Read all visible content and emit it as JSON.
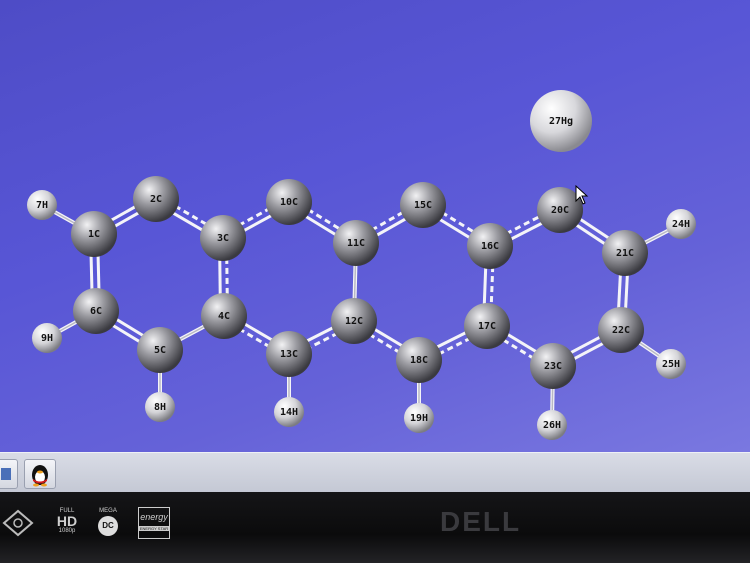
{
  "viewer": {
    "atoms": [
      {
        "id": "1C",
        "label": "1C",
        "el": "C"
      },
      {
        "id": "2C",
        "label": "2C",
        "el": "C"
      },
      {
        "id": "3C",
        "label": "3C",
        "el": "C"
      },
      {
        "id": "4C",
        "label": "4C",
        "el": "C"
      },
      {
        "id": "5C",
        "label": "5C",
        "el": "C"
      },
      {
        "id": "6C",
        "label": "6C",
        "el": "C"
      },
      {
        "id": "7H",
        "label": "7H",
        "el": "H"
      },
      {
        "id": "8H",
        "label": "8H",
        "el": "H"
      },
      {
        "id": "9H",
        "label": "9H",
        "el": "H"
      },
      {
        "id": "10C",
        "label": "10C",
        "el": "C"
      },
      {
        "id": "11C",
        "label": "11C",
        "el": "C"
      },
      {
        "id": "12C",
        "label": "12C",
        "el": "C"
      },
      {
        "id": "13C",
        "label": "13C",
        "el": "C"
      },
      {
        "id": "14H",
        "label": "14H",
        "el": "H"
      },
      {
        "id": "15C",
        "label": "15C",
        "el": "C"
      },
      {
        "id": "16C",
        "label": "16C",
        "el": "C"
      },
      {
        "id": "17C",
        "label": "17C",
        "el": "C"
      },
      {
        "id": "18C",
        "label": "18C",
        "el": "C"
      },
      {
        "id": "19H",
        "label": "19H",
        "el": "H"
      },
      {
        "id": "20C",
        "label": "20C",
        "el": "C"
      },
      {
        "id": "21C",
        "label": "21C",
        "el": "C"
      },
      {
        "id": "22C",
        "label": "22C",
        "el": "C"
      },
      {
        "id": "23C",
        "label": "23C",
        "el": "C"
      },
      {
        "id": "24H",
        "label": "24H",
        "el": "H"
      },
      {
        "id": "25H",
        "label": "25H",
        "el": "H"
      },
      {
        "id": "26H",
        "label": "26H",
        "el": "H"
      },
      {
        "id": "27Hg",
        "label": "27Hg",
        "el": "Hg"
      }
    ],
    "bonds": [
      [
        "1C",
        "2C",
        "double"
      ],
      [
        "2C",
        "3C",
        "aromatic"
      ],
      [
        "3C",
        "4C",
        "aromatic"
      ],
      [
        "4C",
        "5C",
        "single"
      ],
      [
        "5C",
        "6C",
        "double"
      ],
      [
        "6C",
        "1C",
        "double"
      ],
      [
        "1C",
        "7H",
        "single"
      ],
      [
        "6C",
        "9H",
        "single"
      ],
      [
        "5C",
        "8H",
        "single"
      ],
      [
        "3C",
        "10C",
        "aromatic"
      ],
      [
        "10C",
        "11C",
        "aromatic"
      ],
      [
        "11C",
        "12C",
        "single"
      ],
      [
        "12C",
        "13C",
        "aromatic"
      ],
      [
        "13C",
        "4C",
        "aromatic"
      ],
      [
        "13C",
        "14H",
        "single"
      ],
      [
        "11C",
        "15C",
        "aromatic"
      ],
      [
        "15C",
        "16C",
        "aromatic"
      ],
      [
        "16C",
        "17C",
        "aromatic"
      ],
      [
        "17C",
        "18C",
        "aromatic"
      ],
      [
        "18C",
        "12C",
        "aromatic"
      ],
      [
        "18C",
        "19H",
        "single"
      ],
      [
        "16C",
        "20C",
        "aromatic"
      ],
      [
        "20C",
        "21C",
        "double"
      ],
      [
        "21C",
        "22C",
        "double"
      ],
      [
        "22C",
        "23C",
        "double"
      ],
      [
        "23C",
        "17C",
        "aromatic"
      ],
      [
        "21C",
        "24H",
        "single"
      ],
      [
        "22C",
        "25H",
        "single"
      ],
      [
        "23C",
        "26H",
        "single"
      ]
    ]
  },
  "taskbar": {
    "items": [
      "app-icon-1",
      "qq-penguin-icon"
    ]
  },
  "monitor": {
    "brand": "DELL",
    "badges": [
      {
        "name": "full-hd-badge",
        "top": "FULL",
        "main": "HD",
        "sub": "1080p"
      },
      {
        "name": "mega-badge",
        "top": "MEGA",
        "main": "DC",
        "sub": ""
      },
      {
        "name": "energy-star-badge",
        "top": "",
        "main": "energy",
        "sub": "ENERGY STAR"
      }
    ]
  }
}
